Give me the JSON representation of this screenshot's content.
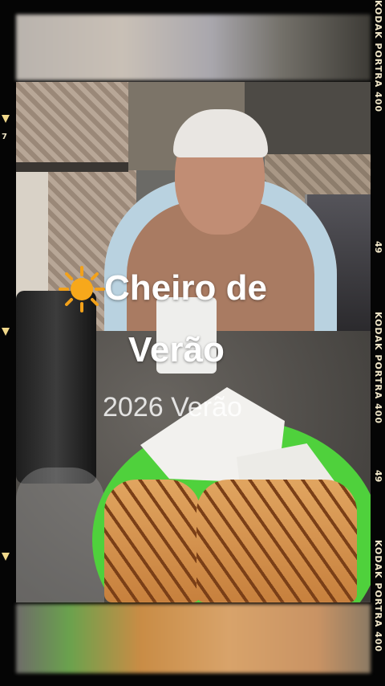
{
  "story": {
    "title_line1": "Cheiro de",
    "title_line2": "Verão",
    "subtitle": "2026 Verão",
    "sun_icon": "sun-icon"
  },
  "film_edge": {
    "brand_text": "KODAK PORTRA 400",
    "frame_number_right": "49",
    "frame_number_left": "7"
  }
}
